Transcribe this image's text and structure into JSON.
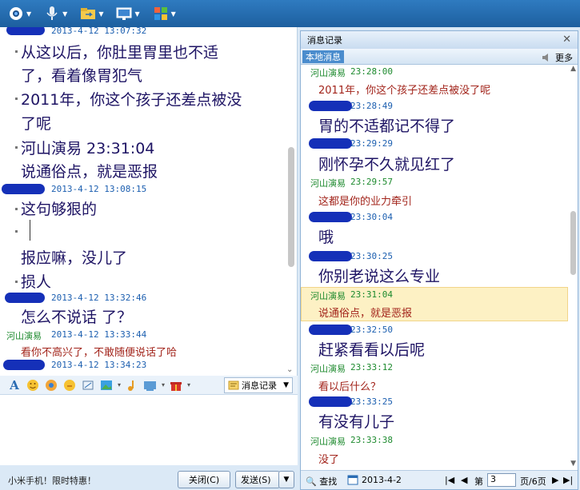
{
  "toolbar": {
    "icons": [
      "webcam-icon",
      "microphone-icon",
      "transfer-file-icon",
      "screen-share-icon",
      "apps-icon"
    ]
  },
  "left_chat": {
    "header_time": "2013-4-12 13:07:32",
    "lines": [
      "从这以后，你肚里胃里也不适",
      "了，看着像胃犯气",
      "2011年，你这个孩子还差点被没",
      "了呢",
      "河山演易  23:31:04",
      "说通俗点，就是恶报"
    ],
    "msg2_time": "2013-4-12 13:08:15",
    "msg2_lines": [
      "这句够狠的",
      "报应嘛，没儿了",
      "损人"
    ],
    "msg3_time": "2013-4-12 13:32:46",
    "msg3_text": "怎么不说话 了？",
    "msg4_sender": "河山演易",
    "msg4_time": "2013-4-12 13:33:44",
    "msg4_text": "看你不高兴了，不敢随便说话了哈",
    "msg5_time": "2013-4-12 13:34:23"
  },
  "input_tools": {
    "history_label": "消息记录"
  },
  "bottom": {
    "ad_text": "小米手机！限时特惠！",
    "close_label": "关闭(C)",
    "send_label": "发送(S)"
  },
  "history_panel": {
    "title": "消息记录",
    "tab_local": "本地消息",
    "more_label": "更多",
    "entries": [
      {
        "sender": "河山演易",
        "time": "23:28:00",
        "text": "2011年，你这个孩子还差点被没了呢"
      },
      {
        "sender": "",
        "time": "23:28:49",
        "text": "胃的不适都记不得了"
      },
      {
        "sender": "",
        "time": "23:29:29",
        "text": "刚怀孕不久就见红了"
      },
      {
        "sender": "河山演易",
        "time": "23:29:57",
        "text": "这都是你的业力牵引"
      },
      {
        "sender": "",
        "time": "23:30:04",
        "text": "哦"
      },
      {
        "sender": "",
        "time": "23:30:25",
        "text": "你别老说这么专业"
      },
      {
        "sender": "河山演易",
        "time": "23:31:04",
        "text": "说通俗点，就是恶报"
      },
      {
        "sender": "",
        "time": "23:32:50",
        "text": "赶紧看看以后呢"
      },
      {
        "sender": "河山演易",
        "time": "23:33:12",
        "text": "看以后什么？"
      },
      {
        "sender": "",
        "time": "23:33:25",
        "text": "有没有儿子"
      },
      {
        "sender": "河山演易",
        "time": "23:33:38",
        "text": "没了"
      }
    ],
    "footer": {
      "search_label": "查找",
      "date": "2013-4-2",
      "page_prefix": "第",
      "page_value": "3",
      "page_suffix": "页/6页"
    }
  }
}
